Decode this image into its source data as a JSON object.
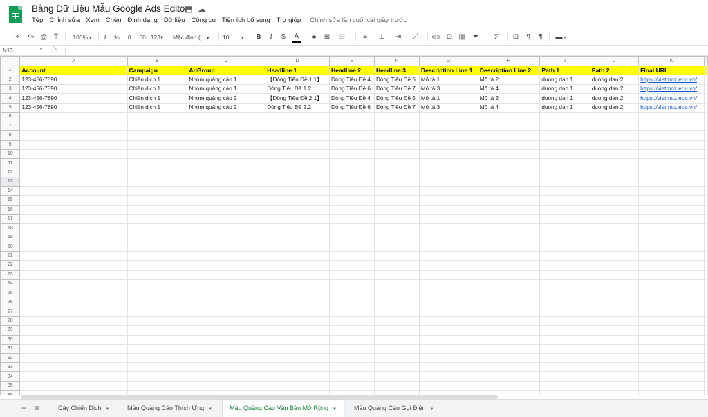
{
  "app": {
    "title": "Bảng Dữ Liệu Mẫu Google Ads Editor",
    "star_icon": "☆",
    "folder_icon": "⬒",
    "cloud_icon": "☁"
  },
  "menu": {
    "items": [
      "Tệp",
      "Chỉnh sửa",
      "Xem",
      "Chèn",
      "Định dạng",
      "Dữ liệu",
      "Công cụ",
      "Tiện ích bổ sung",
      "Trợ giúp"
    ],
    "last_edit": "Chỉnh sửa lần cuối vài giây trước"
  },
  "toolbar": {
    "undo": "↶",
    "redo": "↷",
    "print": "⎙",
    "paint_format": "⍑",
    "zoom": "100%",
    "currency": "₫",
    "percent": "%",
    "decimal_decrease": ".0",
    "decimal_increase": ".00",
    "more_formats": "123▾",
    "font": "Mặc định (...",
    "font_size": "10",
    "bold": "B",
    "italic": "I",
    "strike": "S",
    "text_color": "A",
    "fill_color": "◈",
    "borders": "⊞",
    "merge": "⊟",
    "h_align": "≡",
    "v_align": "⊥",
    "wrap": "⇥",
    "rotate": "⟋",
    "link": "⊂⊃",
    "comment": "⊡",
    "chart": "▥",
    "filter": "⏷",
    "functions": "Σ",
    "ltr": "¶",
    "rtl": "¶",
    "input_tools": "▬"
  },
  "formula_bar": {
    "name_box": "N13",
    "fx": "fx",
    "value": ""
  },
  "grid": {
    "columns": [
      "A",
      "B",
      "C",
      "D",
      "E",
      "F",
      "G",
      "H",
      "I",
      "J",
      "K"
    ],
    "header_row": [
      "Account",
      "Campaign",
      "AdGroup",
      "Headline 1",
      "Headline 2",
      "Headline 3",
      "Description Line 1",
      "Description Line 2",
      "Path 1",
      "Path 2",
      "Final URL"
    ],
    "rows": [
      [
        "123-456-7890",
        "Chiến dịch 1",
        "Nhóm quảng cáo 1",
        "【Dòng Tiêu Đề 1.1】",
        "Dòng Tiêu Đề 4",
        "Dòng Tiêu Đề 5",
        "Mô tả 1",
        "Mô tả 2",
        "duong dan 1",
        "duong dan 2",
        "https://vietmoz.edu.vn/"
      ],
      [
        "123-456-7890",
        "Chiến dịch 1",
        "Nhóm quảng cáo 1",
        "Dòng Tiêu Đề 1.2",
        "Dòng Tiêu Đề 6",
        "Dòng Tiêu Đề 7",
        "Mô tả 3",
        "Mô tả 4",
        "duong dan 1",
        "duong dan 2",
        "https://vietmoz.edu.vn/"
      ],
      [
        "123-456-7890",
        "Chiến dịch 1",
        "Nhóm quảng cáo 2",
        "【Dòng Tiêu Đề 2.1】",
        "Dòng Tiêu Đề 4",
        "Dòng Tiêu Đề 5",
        "Mô tả 1",
        "Mô tả 2",
        "duong dan 1",
        "duong dan 2",
        "https://vietmoz.edu.vn/"
      ],
      [
        "123-456-7890",
        "Chiến dịch 1",
        "Nhóm quảng cáo 2",
        "Dòng Tiêu Đề 2.2",
        "Dòng Tiêu Đề 6",
        "Dòng Tiêu Đề 7",
        "Mô tả 3",
        "Mô tả 4",
        "duong dan 1",
        "duong dan 2",
        "https://vietmoz.edu.vn/"
      ]
    ],
    "row_numbers": [
      "1",
      "2",
      "3",
      "4",
      "5",
      "6",
      "7",
      "8",
      "9",
      "10",
      "11",
      "12",
      "13",
      "14",
      "15",
      "16",
      "17",
      "18",
      "19",
      "20",
      "21",
      "22",
      "23",
      "24",
      "25",
      "26",
      "27",
      "28",
      "29",
      "30",
      "31",
      "32",
      "33",
      "34",
      "35",
      "36"
    ],
    "selected_row": "13"
  },
  "sheets": {
    "add_icon": "+",
    "list_icon": "≡",
    "tabs": [
      {
        "label": "Cây Chiến Dịch",
        "active": false
      },
      {
        "label": "Mẫu Quảng Cáo Thích Ứng",
        "active": false
      },
      {
        "label": "Mẫu Quảng Cáo Văn Bản Mở Rộng",
        "active": true
      },
      {
        "label": "Mẫu Quảng Cáo Gọi Điện",
        "active": false
      }
    ]
  },
  "colors": {
    "header_fill": "#ffff00",
    "active_tab": "#188038",
    "link": "#1155cc",
    "sheets_green": "#0f9d58"
  }
}
